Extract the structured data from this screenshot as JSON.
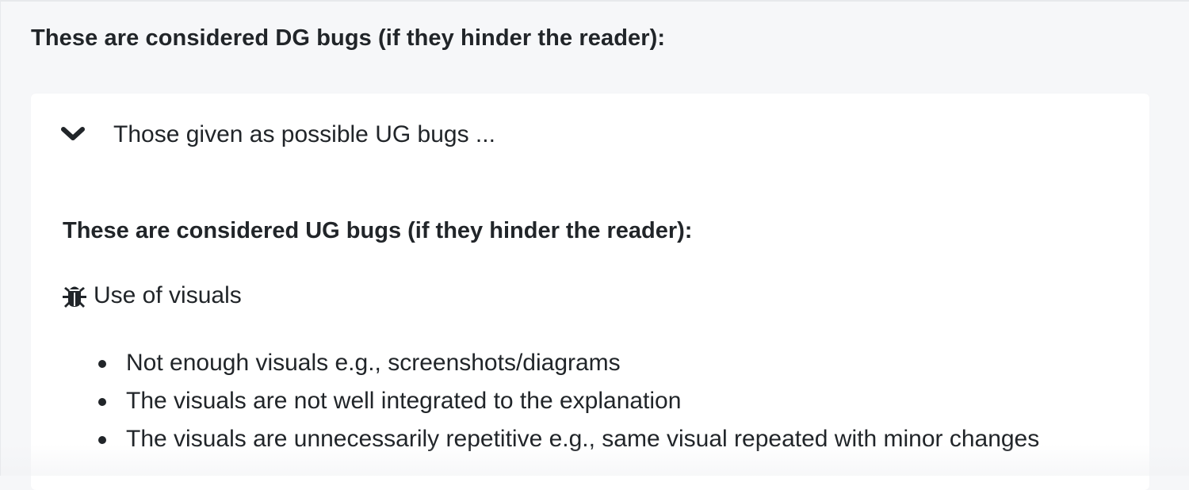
{
  "dg_heading": "These are considered DG bugs (if they hinder the reader):",
  "details": {
    "summary": "Those given as possible UG bugs ...",
    "ug_heading": "These are considered UG bugs (if they hinder the reader):",
    "bug_category": {
      "icon": "bug-icon",
      "label": "Use of visuals"
    },
    "bullets": [
      "Not enough visuals e.g., screenshots/diagrams",
      "The visuals are not well integrated to the explanation",
      "The visuals are unnecessarily repetitive e.g., same visual repeated with minor changes"
    ]
  }
}
